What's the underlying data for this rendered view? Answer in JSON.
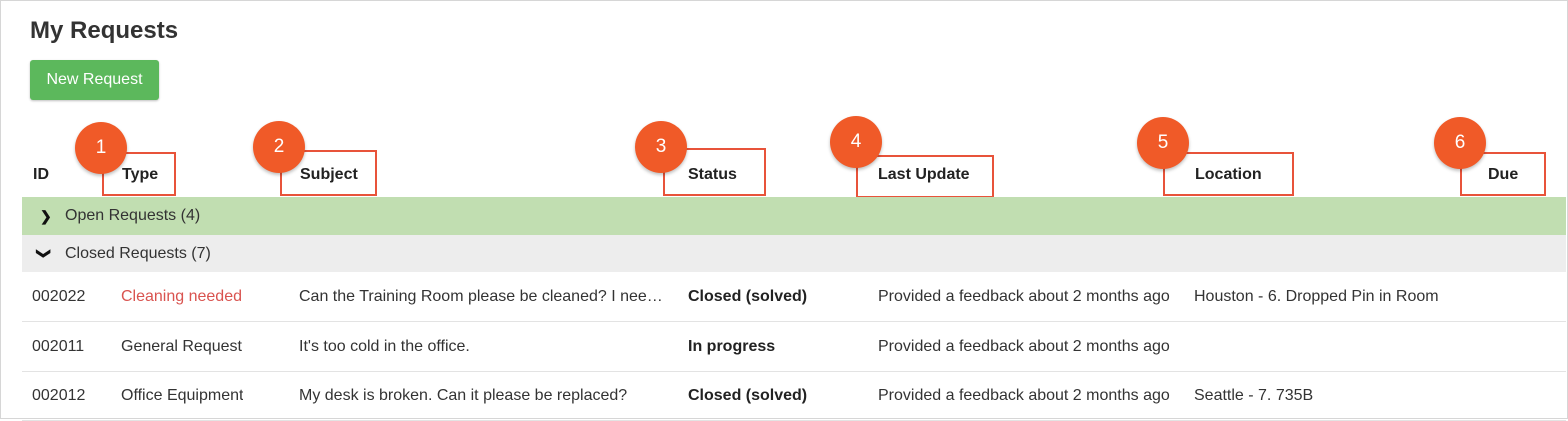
{
  "page": {
    "title": "My Requests",
    "new_request_label": "New Request"
  },
  "table": {
    "headers": {
      "id": "ID",
      "type": "Type",
      "subject": "Subject",
      "status": "Status",
      "last_update": "Last Update",
      "location": "Location",
      "due": "Due"
    },
    "groups": {
      "open": {
        "label": "Open Requests (4)",
        "icon": "chevron-right-icon"
      },
      "closed": {
        "label": "Closed Requests (7)",
        "icon": "chevron-down-icon"
      }
    },
    "rows": [
      {
        "id": "002022",
        "type": "Cleaning needed",
        "subject": "Can the Training Room please be cleaned? I need it for a meeting",
        "status": "Closed (solved)",
        "last_update": "Provided a feedback about 2 months ago",
        "location": "Houston - 6. Dropped Pin in Room",
        "due": ""
      },
      {
        "id": "002011",
        "type": "General Request",
        "subject": "It's too cold in the office.",
        "status": "In progress",
        "last_update": "Provided a feedback about 2 months ago",
        "location": "",
        "due": ""
      },
      {
        "id": "002012",
        "type": "Office Equipment",
        "subject": "My desk is broken. Can it please be replaced?",
        "status": "Closed (solved)",
        "last_update": "Provided a feedback about 2 months ago",
        "location": "Seattle - 7. 735B",
        "due": ""
      }
    ]
  },
  "markers": [
    "1",
    "2",
    "3",
    "4",
    "5",
    "6"
  ],
  "colors": {
    "accent_green": "#5cb85c",
    "open_group_bg": "#c1deb1",
    "marker": "#f05a28",
    "highlight_border": "#e8533a",
    "type_cleaning": "#d9534f"
  }
}
